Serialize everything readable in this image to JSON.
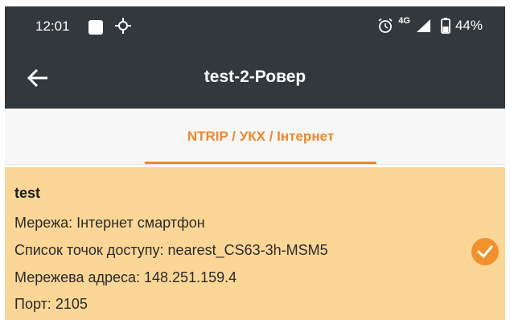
{
  "status_bar": {
    "time": "12:01",
    "network": "4G",
    "battery": "44%"
  },
  "app_bar": {
    "title": "test-2-Ровер"
  },
  "tabs": [
    {
      "label": "NTRIP / УКХ / Інтернет",
      "active": true
    }
  ],
  "connection": {
    "name": "test",
    "network_label": "Мережа:",
    "network_value": "Інтернет смартфон",
    "mountpoint_label": "Список точок доступу:",
    "mountpoint_value": "nearest_CS63-3h-MSM5",
    "address_label": "Мережева адреса:",
    "address_value": "148.251.159.4",
    "port_label": "Порт:",
    "port_value": "2105",
    "selected": true
  },
  "colors": {
    "bar": "#33383c",
    "accent": "#f0872b",
    "card": "#fbd696"
  }
}
